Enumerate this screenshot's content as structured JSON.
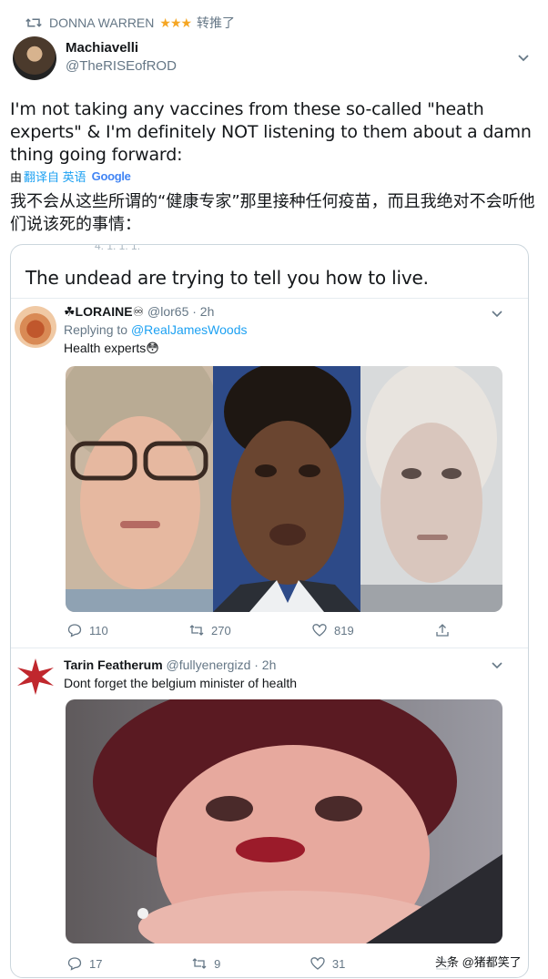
{
  "retweet": {
    "user": "DONNA WARREN",
    "stars": "★★★",
    "label": "转推了"
  },
  "author": {
    "name": "Machiavelli",
    "handle": "@TheRISEofROD"
  },
  "tweet": {
    "text": "I'm not taking any vaccines from these so-called \"heath experts\" & I'm definitely NOT listening to them about a damn thing going forward:",
    "translate_by": "由",
    "translate_from": "翻译自 英语",
    "translate_engine": "Google",
    "translated_text": "我不会从这些所谓的“健康专家”那里接种任何疫苗，而且我绝对不会听他们说该死的事情："
  },
  "embed": {
    "cut_text": "4. 1. 1. 1.",
    "title": "The undead are trying to tell you how to live.",
    "tweets": [
      {
        "name": "☘LORAINE",
        "badge": "♾",
        "handle": "@lor65",
        "time": "· 2h",
        "replying_label": "Replying to ",
        "replying_to": "@RealJamesWoods",
        "text": "Health experts😳",
        "replies": "110",
        "retweets": "270",
        "likes": "819"
      },
      {
        "name": "Tarin Featherum",
        "handle": "@fullyenergizd",
        "time": "· 2h",
        "text": "Dont forget the belgium minister of health",
        "replies": "17",
        "retweets": "9",
        "likes": "31"
      }
    ]
  },
  "watermark": "头条 @猪都笑了",
  "icons": {
    "retweet": "retweet-icon",
    "reply": "reply-icon",
    "like": "heart-icon",
    "share": "share-icon",
    "caret": "chevron-down-icon"
  },
  "colors": {
    "link": "#1da1f2",
    "muted": "#657786",
    "star": "#f5a623",
    "cross": "#c0272d"
  }
}
